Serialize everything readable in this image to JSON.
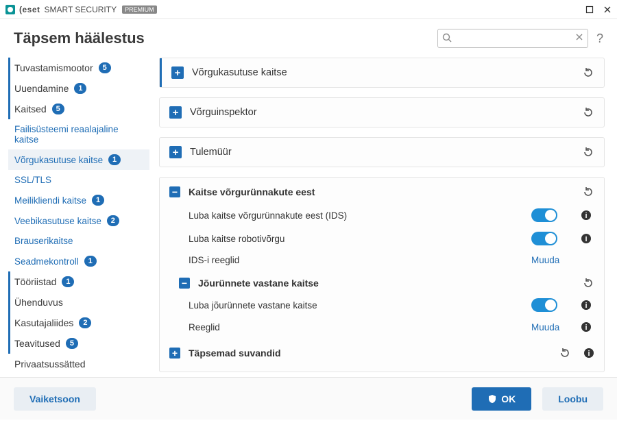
{
  "titlebar": {
    "brand": "(eset",
    "product": "SMART SECURITY",
    "tier": "PREMIUM"
  },
  "header": {
    "title": "Täpsem häälestus",
    "search_placeholder": ""
  },
  "sidebar": {
    "items": [
      {
        "label": "Tuvastamismootor",
        "badge": "5",
        "top": true
      },
      {
        "label": "Uuendamine",
        "badge": "1",
        "top": true
      },
      {
        "label": "Kaitsed",
        "badge": "5",
        "top": true
      },
      {
        "label": "Failisüsteemi reaalajaline kaitse",
        "sub": true
      },
      {
        "label": "Võrgukasutuse kaitse",
        "badge": "1",
        "sub": true,
        "active": true
      },
      {
        "label": "SSL/TLS",
        "sub": true
      },
      {
        "label": "Meilikliendi kaitse",
        "badge": "1",
        "sub": true
      },
      {
        "label": "Veebikasutuse kaitse",
        "badge": "2",
        "sub": true
      },
      {
        "label": "Brauserikaitse",
        "sub": true
      },
      {
        "label": "Seadmekontroll",
        "badge": "1",
        "sub": true
      },
      {
        "label": "Tööriistad",
        "badge": "1",
        "top": true
      },
      {
        "label": "Ühenduvus",
        "top": true
      },
      {
        "label": "Kasutajaliides",
        "badge": "2",
        "top": true
      },
      {
        "label": "Teavitused",
        "badge": "5",
        "top": true
      },
      {
        "label": "Privaatsussätted",
        "top": true
      }
    ]
  },
  "panels": {
    "p1": "Võrgukasutuse kaitse",
    "p2": "Võrguinspektor",
    "p3": "Tulemüür"
  },
  "section_attack": {
    "title": "Kaitse võrgurünnakute eest",
    "row1": "Luba kaitse võrgurünnakute eest (IDS)",
    "row2": "Luba kaitse robotivõrgu",
    "row3": "IDS-i reeglid",
    "edit": "Muuda"
  },
  "section_brute": {
    "title": "Jõurünnete vastane kaitse",
    "row1": "Luba jõurünnete vastane kaitse",
    "row2": "Reeglid",
    "edit": "Muuda"
  },
  "section_adv": {
    "title": "Täpsemad suvandid"
  },
  "footer": {
    "default": "Vaiketsoon",
    "ok": "OK",
    "cancel": "Loobu"
  }
}
